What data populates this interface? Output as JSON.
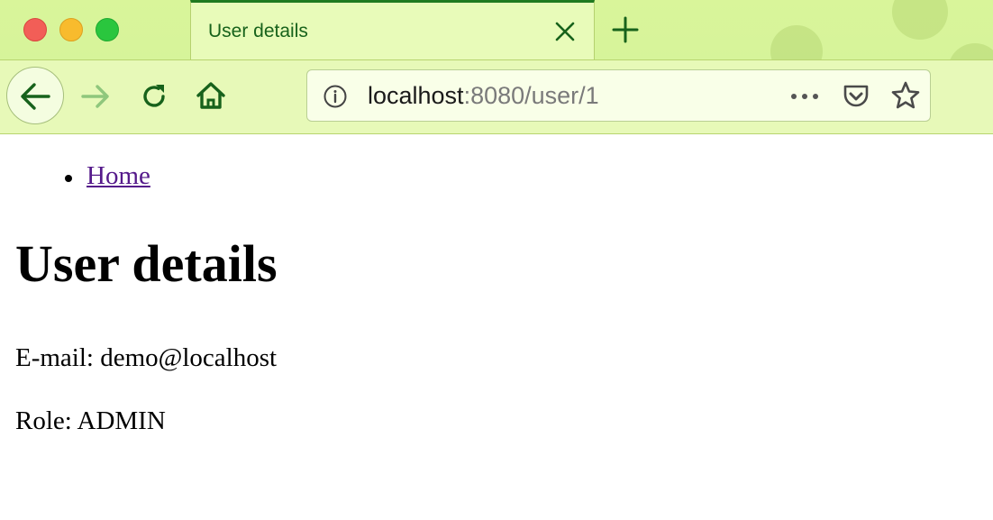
{
  "browser": {
    "tab": {
      "title": "User details"
    },
    "address": {
      "host": "localhost",
      "rest": ":8080/user/1"
    },
    "colors": {
      "chrome": "#d3f39a",
      "accent": "#1f7a1f"
    }
  },
  "page": {
    "nav": [
      {
        "label": "Home"
      }
    ],
    "heading": "User details",
    "email": {
      "label": "E-mail:",
      "value": "demo@localhost"
    },
    "role": {
      "label": "Role:",
      "value": "ADMIN"
    }
  }
}
